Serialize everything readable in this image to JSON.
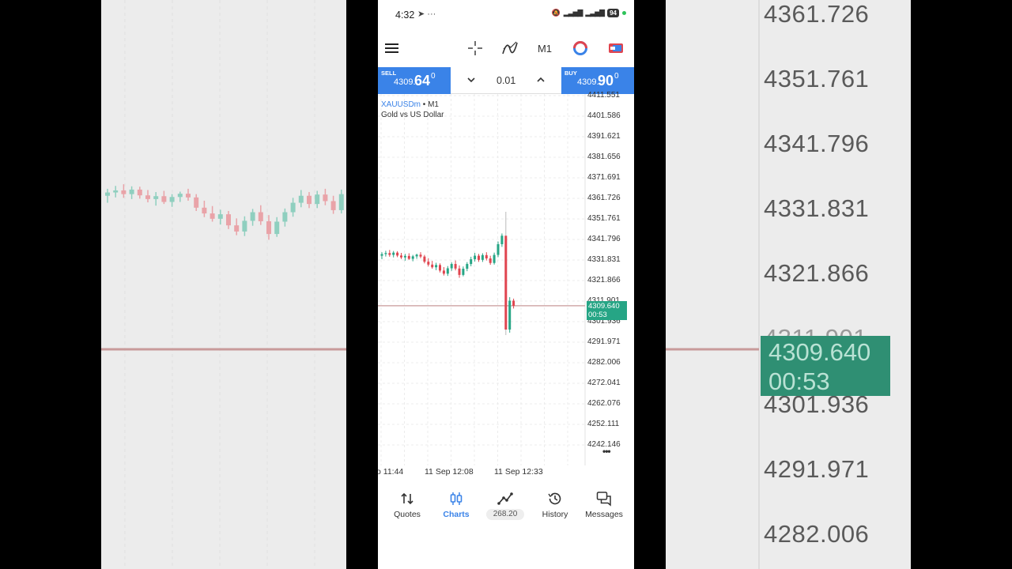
{
  "status_bar": {
    "time": "4:32",
    "left_icons": "telegram-icon",
    "dots": "···",
    "battery": "94"
  },
  "toolbar": {
    "timeframe": "M1"
  },
  "trade": {
    "sell_label": "SELL",
    "sell_price_small": "4309.",
    "sell_price_big": "64",
    "sell_price_sup": "0",
    "lot_value": "0.01",
    "buy_label": "BUY",
    "buy_price_small": "4309.",
    "buy_price_big": "90",
    "buy_price_sup": "0"
  },
  "chart": {
    "symbol": "XAUUSDm",
    "timeframe_suffix": " • M1",
    "description": "Gold vs US Dollar",
    "price_levels": [
      "4411.551",
      "4401.586",
      "4391.621",
      "4381.656",
      "4371.691",
      "4361.726",
      "4351.761",
      "4341.796",
      "4331.831",
      "4321.866",
      "4311.901",
      "4301.936",
      "4291.971",
      "4282.006",
      "4272.041",
      "4262.076",
      "4252.111",
      "4242.146"
    ],
    "current_price": "4309.640",
    "countdown": "00:53",
    "time_labels": [
      "o 11:44",
      "11 Sep 12:08",
      "11 Sep 12:33"
    ],
    "more": "•••"
  },
  "chart_data": {
    "type": "candlestick",
    "symbol": "XAUUSDm",
    "timeframe": "M1",
    "ylim": [
      4238,
      4414
    ],
    "x_labels": [
      "11:44",
      "11 Sep 12:08",
      "11 Sep 12:33"
    ],
    "current_price": 4309.64,
    "candles": [
      {
        "o": 4333.9,
        "h": 4335.6,
        "l": 4332.2,
        "c": 4334.7
      },
      {
        "o": 4334.7,
        "h": 4336.3,
        "l": 4333.5,
        "c": 4335.2
      },
      {
        "o": 4335.2,
        "h": 4336.7,
        "l": 4333.4,
        "c": 4334.3
      },
      {
        "o": 4334.3,
        "h": 4336.2,
        "l": 4333.1,
        "c": 4335.4
      },
      {
        "o": 4335.4,
        "h": 4336.1,
        "l": 4333.2,
        "c": 4334.0
      },
      {
        "o": 4334.0,
        "h": 4335.3,
        "l": 4332.3,
        "c": 4333.1
      },
      {
        "o": 4333.1,
        "h": 4334.8,
        "l": 4331.5,
        "c": 4333.8
      },
      {
        "o": 4333.8,
        "h": 4335.1,
        "l": 4331.9,
        "c": 4332.4
      },
      {
        "o": 4332.4,
        "h": 4334.3,
        "l": 4331.2,
        "c": 4333.6
      },
      {
        "o": 4333.6,
        "h": 4334.9,
        "l": 4332.4,
        "c": 4334.4
      },
      {
        "o": 4334.4,
        "h": 4335.6,
        "l": 4332.7,
        "c": 4333.5
      },
      {
        "o": 4333.5,
        "h": 4334.3,
        "l": 4330.2,
        "c": 4331.0
      },
      {
        "o": 4331.0,
        "h": 4332.7,
        "l": 4328.7,
        "c": 4329.6
      },
      {
        "o": 4329.6,
        "h": 4331.4,
        "l": 4327.6,
        "c": 4328.3
      },
      {
        "o": 4328.3,
        "h": 4330.5,
        "l": 4326.9,
        "c": 4329.4
      },
      {
        "o": 4329.4,
        "h": 4330.2,
        "l": 4325.8,
        "c": 4326.7
      },
      {
        "o": 4326.7,
        "h": 4328.4,
        "l": 4324.3,
        "c": 4325.2
      },
      {
        "o": 4325.2,
        "h": 4328.9,
        "l": 4324.1,
        "c": 4327.8
      },
      {
        "o": 4327.8,
        "h": 4330.7,
        "l": 4326.6,
        "c": 4329.9
      },
      {
        "o": 4329.9,
        "h": 4331.6,
        "l": 4326.8,
        "c": 4327.7
      },
      {
        "o": 4327.7,
        "h": 4329.2,
        "l": 4323.2,
        "c": 4324.6
      },
      {
        "o": 4324.6,
        "h": 4328.7,
        "l": 4323.9,
        "c": 4327.6
      },
      {
        "o": 4327.6,
        "h": 4330.8,
        "l": 4326.4,
        "c": 4329.9
      },
      {
        "o": 4329.9,
        "h": 4333.4,
        "l": 4328.8,
        "c": 4332.2
      },
      {
        "o": 4332.2,
        "h": 4335.3,
        "l": 4331.1,
        "c": 4333.9
      },
      {
        "o": 4333.9,
        "h": 4334.8,
        "l": 4330.9,
        "c": 4331.9
      },
      {
        "o": 4331.9,
        "h": 4335.1,
        "l": 4330.9,
        "c": 4334.2
      },
      {
        "o": 4334.2,
        "h": 4335.6,
        "l": 4331.6,
        "c": 4332.6
      },
      {
        "o": 4332.6,
        "h": 4333.9,
        "l": 4329.5,
        "c": 4330.4
      },
      {
        "o": 4330.4,
        "h": 4335.4,
        "l": 4329.6,
        "c": 4334.3
      },
      {
        "o": 4334.3,
        "h": 4340.8,
        "l": 4333.2,
        "c": 4339.5
      },
      {
        "o": 4339.5,
        "h": 4344.7,
        "l": 4338.2,
        "c": 4343.6
      },
      {
        "o": 4343.6,
        "h": 4355.2,
        "l": 4295.4,
        "c": 4298.1
      },
      {
        "o": 4298.1,
        "h": 4313.8,
        "l": 4296.6,
        "c": 4312.1
      },
      {
        "o": 4312.1,
        "h": 4313.1,
        "l": 4308.3,
        "c": 4309.6
      }
    ]
  },
  "nav": {
    "quotes": "Quotes",
    "charts": "Charts",
    "balance": "268.20",
    "history": "History",
    "messages": "Messages"
  },
  "colors": {
    "accent": "#3a83e8",
    "bull": "#26a585",
    "bear": "#e0454f",
    "price_line": "#c89a9a"
  },
  "background": {
    "prices": [
      "4361.726",
      "4351.761",
      "4341.796",
      "4331.831",
      "4321.866",
      "4311.901",
      "4301.936",
      "4291.971",
      "4282.006"
    ],
    "current_price": "4309.640",
    "countdown": "00:53"
  }
}
